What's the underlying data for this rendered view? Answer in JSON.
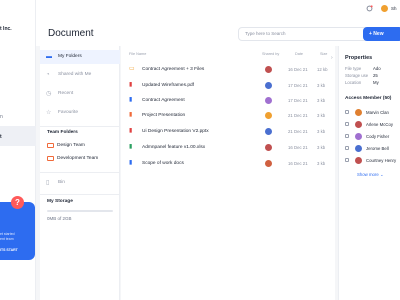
{
  "app": {
    "brand_name": "t Inc.",
    "brand_sub": "",
    "nav_items": [
      {
        "label": "",
        "top": 0
      },
      {
        "label": "n",
        "top": 0
      },
      {
        "label": "t",
        "top": 0
      }
    ],
    "promo": {
      "badge": "?",
      "text_line1": "et started",
      "text_line2": "ent team",
      "cta": "ITS START"
    }
  },
  "header": {
    "title": "Document",
    "search_placeholder": "Type here to Search",
    "new_button": "+ New",
    "user_name": "Sh"
  },
  "folders": {
    "items": [
      {
        "label": "My Folders",
        "icon": "folder-icon",
        "active": true
      },
      {
        "label": "Shared with Me",
        "icon": "share-icon",
        "active": false
      },
      {
        "label": "Recent",
        "icon": "clock-icon",
        "active": false
      },
      {
        "label": "Favourite",
        "icon": "star-icon",
        "active": false
      }
    ],
    "team_title": "Team Folders",
    "team_items": [
      "Design Team",
      "Development Team"
    ],
    "bin_label": "Bin",
    "storage_title": "My Storage",
    "storage_text": "0MB of  2GB",
    "storage_fraction": 0.0
  },
  "files": {
    "columns": [
      "File Name",
      "Shared by",
      "Date",
      "Size"
    ],
    "rows": [
      {
        "icon": "folder-icon",
        "color": "#f0a030",
        "name": "Contract Agreement + 3 Files",
        "date": "16 Dec 21",
        "size": "12 kb",
        "avatar": "#c05050"
      },
      {
        "icon": "pdf-icon",
        "color": "#e04040",
        "name": "Updated Wireframes.pdf",
        "date": "17 Dec 21",
        "size": "3 kb",
        "avatar": "#4a6fd0"
      },
      {
        "icon": "doc-icon",
        "color": "#2d6cf0",
        "name": "Contract Agreement",
        "date": "17 Dec 21",
        "size": "3 kb",
        "avatar": "#a070d0"
      },
      {
        "icon": "pptx-icon",
        "color": "#f06a3a",
        "name": "Project Presentation",
        "date": "21 Dec 21",
        "size": "3 kb",
        "avatar": "#f0a030"
      },
      {
        "icon": "pdf-icon",
        "color": "#e04040",
        "name": "Ui Design Presentation V2.pptx",
        "date": "21 Dec 21",
        "size": "3 kb",
        "avatar": "#4a6fd0"
      },
      {
        "icon": "xlsx-icon",
        "color": "#2aa060",
        "name": "Admnpanel feature v1.00.xlsx",
        "date": "16 Dec 21",
        "size": "3 kb",
        "avatar": "#c05050"
      },
      {
        "icon": "doc-icon",
        "color": "#2d6cf0",
        "name": "Scope of work docs",
        "date": "16 Dec 21",
        "size": "3 kb",
        "avatar": "#d06040"
      }
    ]
  },
  "properties": {
    "title": "Properties",
    "rows": [
      {
        "key": "File type",
        "value": "Ado"
      },
      {
        "key": "Storage use",
        "value": "25"
      },
      {
        "key": "Location",
        "value": "My"
      }
    ],
    "access_title": "Access Member (50)",
    "members": [
      {
        "name": "Marvin Clan",
        "avatar": "#e08030"
      },
      {
        "name": "Arlene McCoy",
        "avatar": "#c05050"
      },
      {
        "name": "Cody Fisher",
        "avatar": "#a070d0"
      },
      {
        "name": "Jerome Bell",
        "avatar": "#4a6fd0"
      },
      {
        "name": "Courtney Henry",
        "avatar": "#c05050"
      }
    ],
    "show_more": "Show more"
  }
}
